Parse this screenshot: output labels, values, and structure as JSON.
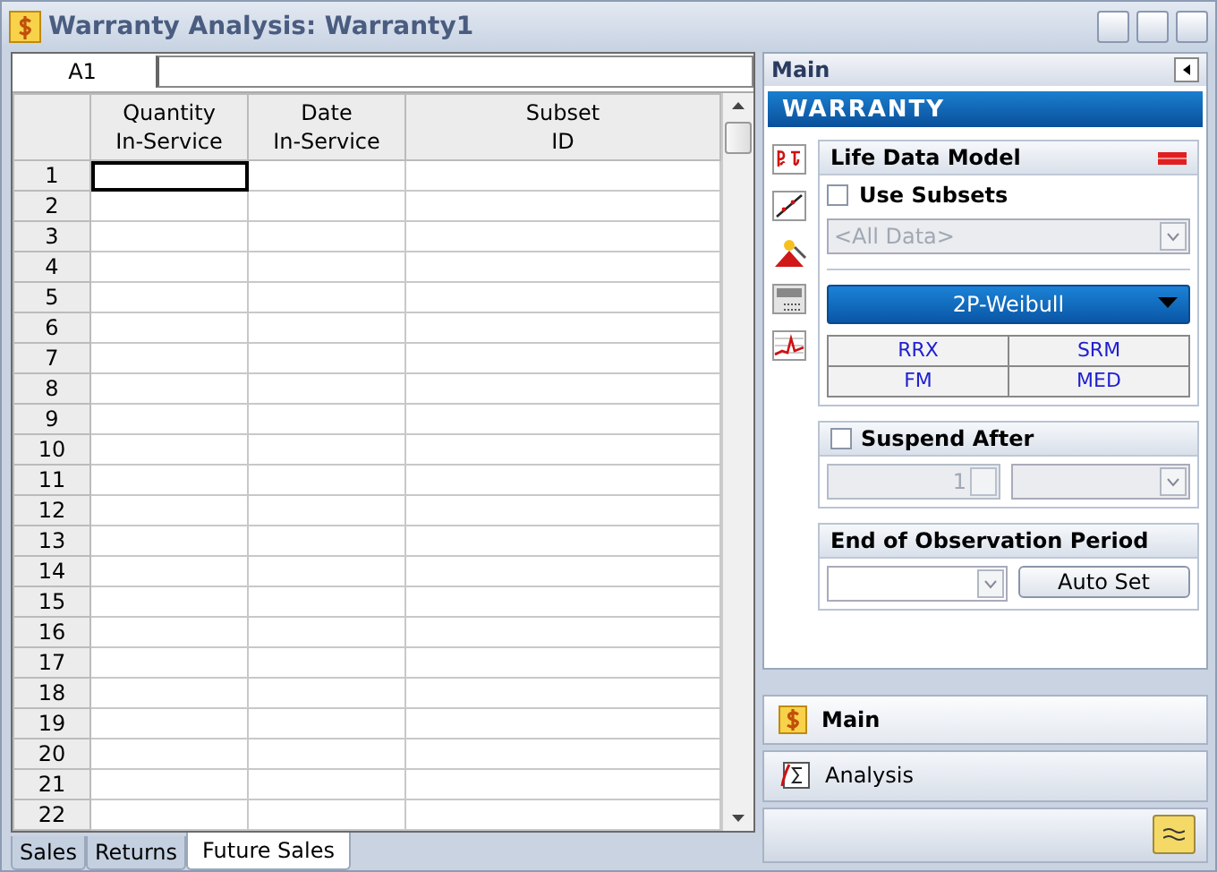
{
  "window": {
    "title": "Warranty Analysis: Warranty1"
  },
  "sheet": {
    "cell_ref": "A1",
    "columns": [
      {
        "line1": "Quantity",
        "line2": "In-Service"
      },
      {
        "line1": "Date",
        "line2": "In-Service"
      },
      {
        "line1": "Subset",
        "line2": "ID"
      }
    ],
    "rows": [
      {
        "label": "1",
        "selected_cells": [
          true,
          false,
          false
        ]
      },
      {
        "label": "2",
        "selected_cells": [
          false,
          false,
          false
        ]
      },
      {
        "label": "3",
        "selected_cells": [
          false,
          false,
          false
        ]
      },
      {
        "label": "4",
        "selected_cells": [
          false,
          false,
          false
        ]
      },
      {
        "label": "5",
        "selected_cells": [
          false,
          false,
          false
        ]
      },
      {
        "label": "6",
        "selected_cells": [
          false,
          false,
          false
        ]
      },
      {
        "label": "7",
        "selected_cells": [
          false,
          false,
          false
        ]
      },
      {
        "label": "8",
        "selected_cells": [
          false,
          false,
          false
        ]
      },
      {
        "label": "9",
        "selected_cells": [
          false,
          false,
          false
        ]
      },
      {
        "label": "10",
        "selected_cells": [
          false,
          false,
          false
        ]
      },
      {
        "label": "11",
        "selected_cells": [
          false,
          false,
          false
        ]
      },
      {
        "label": "12",
        "selected_cells": [
          false,
          false,
          false
        ]
      },
      {
        "label": "13",
        "selected_cells": [
          false,
          false,
          false
        ]
      },
      {
        "label": "14",
        "selected_cells": [
          false,
          false,
          false
        ]
      },
      {
        "label": "15",
        "selected_cells": [
          false,
          false,
          false
        ]
      },
      {
        "label": "16",
        "selected_cells": [
          false,
          false,
          false
        ]
      },
      {
        "label": "17",
        "selected_cells": [
          false,
          false,
          false
        ]
      },
      {
        "label": "18",
        "selected_cells": [
          false,
          false,
          false
        ]
      },
      {
        "label": "19",
        "selected_cells": [
          false,
          false,
          false
        ]
      },
      {
        "label": "20",
        "selected_cells": [
          false,
          false,
          false
        ]
      },
      {
        "label": "21",
        "selected_cells": [
          false,
          false,
          false
        ]
      },
      {
        "label": "22",
        "selected_cells": [
          false,
          false,
          false
        ]
      }
    ]
  },
  "tabs": [
    {
      "label": "Sales",
      "selected": false
    },
    {
      "label": "Returns",
      "selected": false
    },
    {
      "label": "Future Sales",
      "selected": true
    }
  ],
  "panel": {
    "title": "Main",
    "banner": "WARRANTY",
    "life_data_model": {
      "title": "Life Data Model",
      "use_subsets": {
        "label": "Use Subsets",
        "checked": false
      },
      "subset_placeholder": "<All Data>",
      "distribution": "2P-Weibull",
      "methods": [
        "RRX",
        "SRM",
        "FM",
        "MED"
      ]
    },
    "suspend_after": {
      "label": "Suspend After",
      "checked": false,
      "value": "1"
    },
    "end_of_observation": {
      "title": "End of Observation Period",
      "button": "Auto Set"
    }
  },
  "nav": [
    {
      "label": "Main",
      "selected": true,
      "kind": "main"
    },
    {
      "label": "Analysis",
      "selected": false,
      "kind": "analysis"
    }
  ]
}
